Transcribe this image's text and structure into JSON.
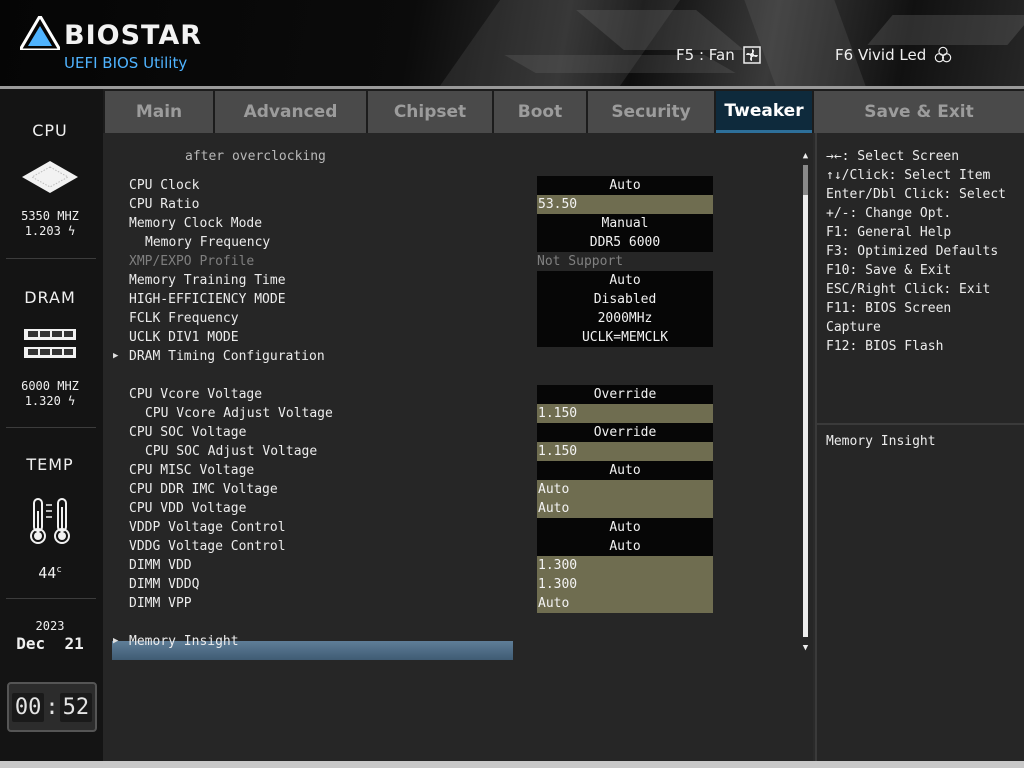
{
  "header": {
    "brand": "BIOSTAR",
    "subtitle": "UEFI BIOS Utility",
    "hotkeys": [
      {
        "label": "F5 : Fan",
        "icon": "fan-icon"
      },
      {
        "label": "F6  Vivid Led",
        "icon": "vivid-led-icon"
      }
    ]
  },
  "status": {
    "cpu": {
      "title": "CPU",
      "freq": "5350 MHZ",
      "volt": "1.203"
    },
    "dram": {
      "title": "DRAM",
      "freq": "6000 MHZ",
      "volt": "1.320"
    },
    "temp": {
      "title": "TEMP",
      "value": "44"
    },
    "date": {
      "year": "2023",
      "day": "Dec  21"
    },
    "clock": {
      "hours": "00",
      "minutes": "52"
    }
  },
  "tabs": [
    {
      "label": "Main"
    },
    {
      "label": "Advanced"
    },
    {
      "label": "Chipset"
    },
    {
      "label": "Boot"
    },
    {
      "label": "Security"
    },
    {
      "label": "Tweaker",
      "active": true
    },
    {
      "label": "Save & Exit"
    }
  ],
  "settings": {
    "top_note": "after overclocking",
    "rows": [
      {
        "label": "CPU Clock",
        "value": "Auto",
        "style": "box"
      },
      {
        "label": "CPU Ratio",
        "value": "53.50",
        "style": "olive"
      },
      {
        "label": "Memory Clock Mode",
        "value": "Manual",
        "style": "box"
      },
      {
        "label": "Memory Frequency",
        "value": "DDR5 6000",
        "style": "box"
      },
      {
        "label": "XMP/EXPO Profile",
        "value": "Not Support",
        "style": "plain"
      },
      {
        "label": "Memory Training Time",
        "value": "Auto",
        "style": "box"
      },
      {
        "label": "HIGH-EFFICIENCY MODE",
        "value": "Disabled",
        "style": "box"
      },
      {
        "label": "FCLK Frequency",
        "value": "2000MHz",
        "style": "box"
      },
      {
        "label": "UCLK DIV1 MODE",
        "value": "UCLK=MEMCLK",
        "style": "box"
      },
      {
        "label": "DRAM Timing Configuration",
        "value": "",
        "style": "submenu"
      },
      {
        "label": "CPU Vcore Voltage",
        "value": "Override",
        "style": "box"
      },
      {
        "label": "CPU Vcore Adjust Voltage",
        "value": "1.150",
        "style": "olive"
      },
      {
        "label": "CPU SOC Voltage",
        "value": "Override",
        "style": "box"
      },
      {
        "label": "CPU SOC Adjust Voltage",
        "value": "1.150",
        "style": "olive"
      },
      {
        "label": "CPU MISC Voltage",
        "value": "Auto",
        "style": "box"
      },
      {
        "label": "CPU DDR IMC Voltage",
        "value": "Auto",
        "style": "olive"
      },
      {
        "label": "CPU VDD Voltage",
        "value": "Auto",
        "style": "olive"
      },
      {
        "label": "VDDP Voltage Control",
        "value": "Auto",
        "style": "box"
      },
      {
        "label": "VDDG Voltage Control",
        "value": "Auto",
        "style": "box"
      },
      {
        "label": "DIMM VDD",
        "value": "1.300",
        "style": "olive"
      },
      {
        "label": "DIMM VDDQ",
        "value": "1.300",
        "style": "olive"
      },
      {
        "label": "DIMM VPP",
        "value": "Auto",
        "style": "olive"
      },
      {
        "label": "Memory Insight",
        "value": "",
        "style": "submenu-selected"
      }
    ]
  },
  "help": {
    "keys": [
      "→←: Select Screen",
      "↑↓/Click: Select Item",
      "Enter/Dbl Click: Select",
      "+/-: Change Opt.",
      "F1: General Help",
      "F3: Optimized Defaults",
      "F10: Save & Exit",
      "ESC/Right Click: Exit",
      "F11: BIOS Screen",
      "Capture",
      "F12: BIOS Flash"
    ],
    "description": "Memory Insight"
  },
  "colors": {
    "accent": "#4fb3ff",
    "active_tab": "#0e2a3c",
    "field_box": "#060606",
    "field_olive": "#6f6d50",
    "selected_row": "#4f6d86"
  }
}
